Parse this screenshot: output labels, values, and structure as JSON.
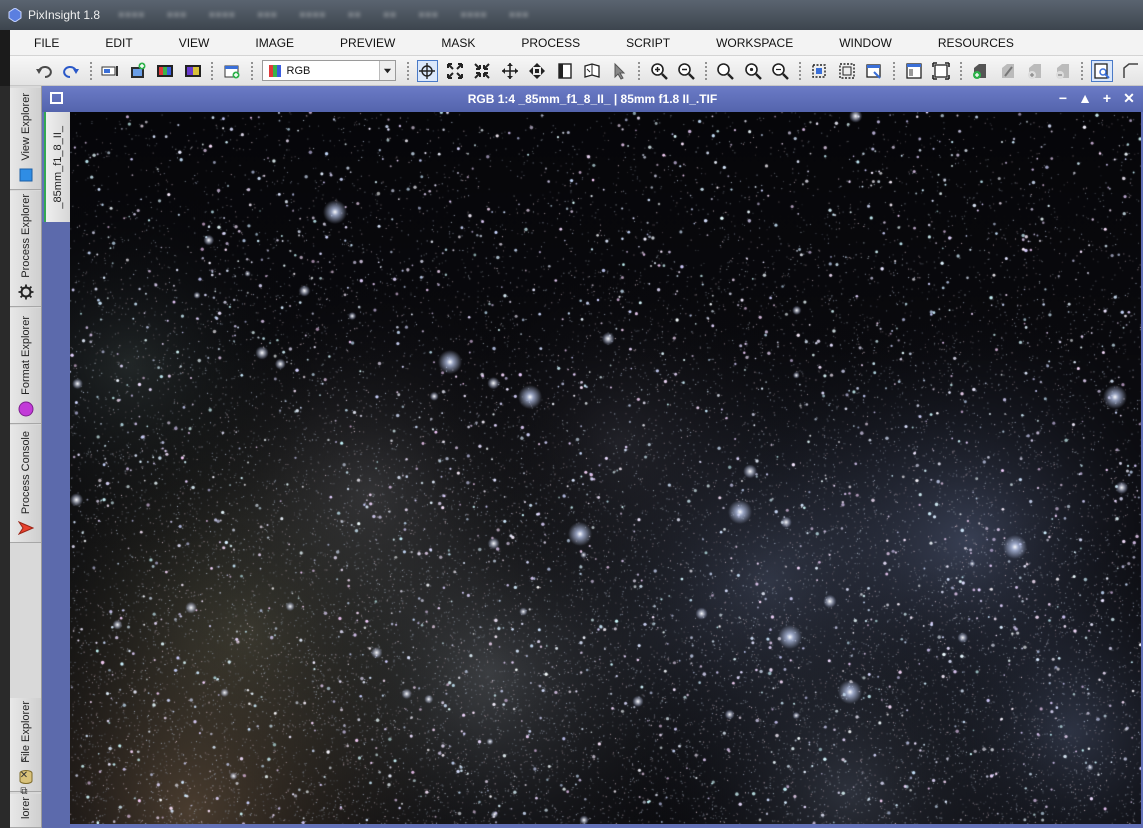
{
  "window": {
    "title": "PixInsight 1.8"
  },
  "menu": {
    "items": [
      "FILE",
      "EDIT",
      "VIEW",
      "IMAGE",
      "PREVIEW",
      "MASK",
      "PROCESS",
      "SCRIPT",
      "WORKSPACE",
      "WINDOW",
      "RESOURCES"
    ]
  },
  "toolbar": {
    "color_space_select": {
      "value": "RGB"
    }
  },
  "dock": {
    "tabs": [
      {
        "label": "View Explorer",
        "icon": "view-explorer-icon"
      },
      {
        "label": "Process Explorer",
        "icon": "gear-icon"
      },
      {
        "label": "Format Explorer",
        "icon": "format-explorer-icon"
      },
      {
        "label": "Process Console",
        "icon": "process-console-icon"
      },
      {
        "label": "File Explorer",
        "icon": "file-explorer-icon"
      },
      {
        "label": "lorer",
        "icon": ""
      }
    ]
  },
  "image_window": {
    "title": "RGB 1:4 _85mm_f1_8_II_ | 85mm f1.8 II_.TIF",
    "view_tab_label": "_85mm_f1_8_II_"
  },
  "colors": {
    "image_window_frame": "#6472b8",
    "menu_background": "#f3f3f3",
    "view_tab_accent": "#34a853"
  }
}
